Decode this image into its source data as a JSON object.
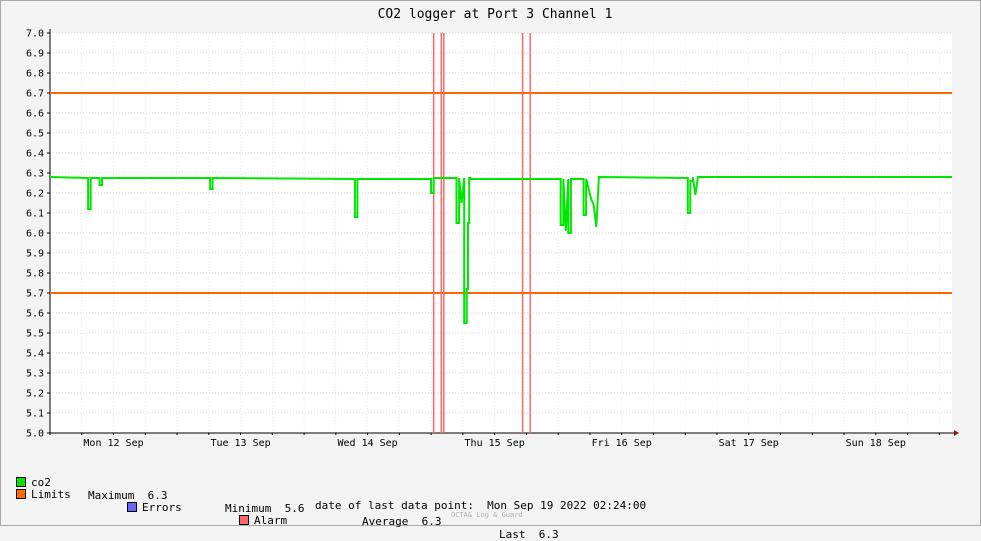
{
  "chart_data": {
    "type": "line",
    "title": "CO2 logger at Port 3 Channel 1",
    "xlabel": "",
    "ylabel": "",
    "ylim": [
      5.0,
      7.0
    ],
    "yticks": [
      5.0,
      5.1,
      5.2,
      5.3,
      5.4,
      5.5,
      5.6,
      5.7,
      5.8,
      5.9,
      6.0,
      6.1,
      6.2,
      6.3,
      6.4,
      6.5,
      6.6,
      6.7,
      6.8,
      6.9,
      7.0
    ],
    "ytick_labels": [
      "5.0",
      "5.1",
      "5.2",
      "5.3",
      "5.4",
      "5.5",
      "5.6",
      "5.7",
      "5.8",
      "5.9",
      "6.0",
      "6.1",
      "6.2",
      "6.3",
      "6.4",
      "6.5",
      "6.6",
      "6.7",
      "6.8",
      "6.9",
      "7.0"
    ],
    "xlim": [
      0,
      7.1
    ],
    "x_unit": "days",
    "x_days": [
      "Mon 12 Sep",
      "Tue 13 Sep",
      "Wed 14 Sep",
      "Thu 15 Sep",
      "Fri 16 Sep",
      "Sat 17 Sep",
      "Sun 18 Sep"
    ],
    "grid": true,
    "legend_placement": "bottom-left",
    "series": [
      {
        "name": "co2",
        "color": "#00e600",
        "baseline": 6.275,
        "x": [
          0.0,
          0.3,
          0.3,
          0.32,
          0.32,
          0.39,
          0.39,
          0.41,
          0.41,
          1.26,
          1.26,
          1.28,
          1.28,
          2.4,
          2.4,
          2.42,
          2.42,
          3.0,
          3.0,
          3.02,
          3.02,
          3.2,
          3.2,
          3.22,
          3.22,
          3.24,
          3.24,
          3.26,
          3.26,
          3.28,
          3.28,
          3.29,
          3.29,
          3.3,
          3.3,
          3.31,
          3.31,
          4.02,
          4.02,
          4.04,
          4.04,
          4.06,
          4.06,
          4.08,
          4.08,
          4.1,
          4.1,
          4.12,
          4.12,
          4.14,
          4.14,
          4.2,
          4.2,
          4.22,
          4.22,
          4.26,
          4.26,
          4.28,
          4.28,
          4.3,
          4.3,
          4.32,
          4.32,
          5.02,
          5.02,
          5.04,
          5.04,
          5.06,
          5.06,
          5.08,
          5.08,
          5.1,
          5.1,
          7.1
        ],
        "y": [
          6.28,
          6.275,
          6.12,
          6.12,
          6.275,
          6.275,
          6.24,
          6.24,
          6.275,
          6.275,
          6.22,
          6.22,
          6.275,
          6.27,
          6.08,
          6.08,
          6.27,
          6.27,
          6.2,
          6.2,
          6.275,
          6.275,
          6.05,
          6.05,
          6.275,
          6.15,
          6.15,
          6.275,
          5.55,
          5.55,
          5.72,
          5.72,
          6.05,
          6.05,
          6.275,
          6.275,
          6.27,
          6.27,
          6.04,
          6.04,
          6.27,
          6.01,
          6.01,
          6.27,
          6.0,
          6.0,
          6.27,
          6.27,
          6.27,
          6.27,
          6.27,
          6.27,
          6.09,
          6.09,
          6.27,
          6.17,
          6.17,
          6.14,
          6.14,
          6.03,
          6.03,
          6.27,
          6.28,
          6.275,
          6.1,
          6.1,
          6.26,
          6.26,
          6.28,
          6.19,
          6.19,
          6.28,
          6.28,
          6.28
        ]
      }
    ],
    "limits": {
      "color": "#ff6600",
      "values": [
        6.7,
        5.7
      ]
    },
    "alarms": {
      "color": "#ff6666",
      "x": [
        3.02,
        3.08,
        3.1,
        3.72,
        3.78
      ]
    },
    "stats": {
      "maximum_label": "Maximum",
      "maximum": "6.3",
      "minimum_label": "Minimum",
      "minimum": "5.6",
      "average_label": "Average",
      "average": "6.3",
      "last_label": "Last",
      "last": "6.3"
    }
  },
  "legend": {
    "co2_label": "co2",
    "co2_color": "#00e600",
    "limits_label": "Limits",
    "limits_color": "#ff6600",
    "errors_label": "Errors",
    "errors_color": "#6666ff",
    "alarm_label": "Alarm",
    "alarm_color": "#ff6666"
  },
  "footer": {
    "last_point": "date of last data point:  Mon Sep 19 2022 02:24:00",
    "watermark": "OCTA& Log & Guard"
  }
}
